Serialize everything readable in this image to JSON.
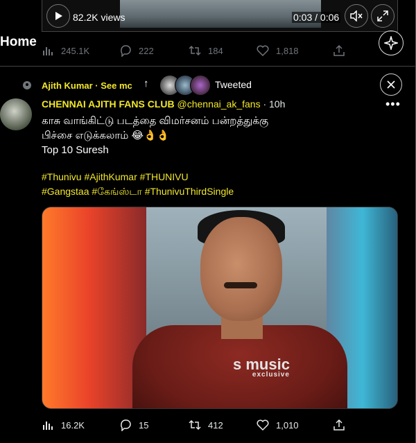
{
  "player": {
    "views": "82.2K views",
    "time": "0:03 / 0:06"
  },
  "header": {
    "title": "Home"
  },
  "prev_tweet_metrics": {
    "views": "245.1K",
    "replies": "222",
    "retweets": "184",
    "likes": "1,818"
  },
  "retweet_bar": {
    "retweeter": "Ajith Kumar · See mc",
    "action_label": "Tweeted"
  },
  "tweet": {
    "author_name": "CHENNAI AJITH FANS CLUB",
    "author_handle": "@chennai_ak_fans",
    "time": "· 10h",
    "text_line1": "காசு வாங்கிட்டு படத்தை விமர்சனம் பன்றத்துக்கு",
    "text_line2": "பிச்சை எடுக்கலாம் 😂👌👌",
    "text_line3": "Top 10 Suresh",
    "hashtags_line1": "#Thunivu #AjithKumar #THUNIVU",
    "hashtags_line2": "#Gangstaa #கேங்ஸ்டா  #ThunivuThirdSingle",
    "watermark": "s music",
    "watermark_sub": "exclusive"
  },
  "tweet_metrics": {
    "views": "16.2K",
    "replies": "15",
    "retweets": "412",
    "likes": "1,010"
  },
  "colors": {
    "accent_yellow": "#f2e72c",
    "background": "#000000",
    "muted": "#71767b"
  }
}
